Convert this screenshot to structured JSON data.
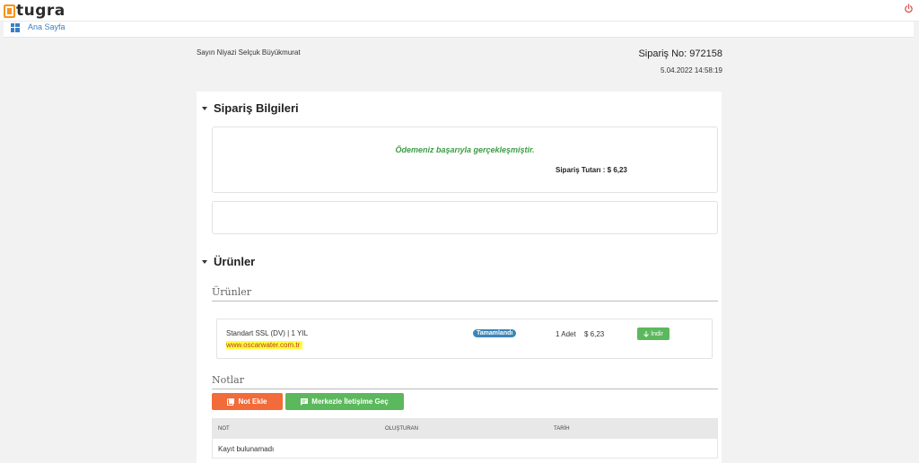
{
  "header": {
    "logo_letter": "E",
    "logo_text": "tugra"
  },
  "nav": {
    "home_label": "Ana Sayfa"
  },
  "order": {
    "customer": "Sayın Niyazi Selçuk Büyükmurat",
    "number": "Sipariş No: 972158",
    "date": "5.04.2022 14:58:19"
  },
  "sections": {
    "order_info_title": "Sipariş Bilgileri",
    "products_title": "Ürünler",
    "products_subtitle": "Ürünler",
    "notes_subtitle": "Notlar"
  },
  "payment": {
    "success_message": "Ödemeniz başarıyla gerçekleşmiştir.",
    "total": "Sipariş Tutarı : $ 6,23"
  },
  "product": {
    "name": "Standart SSL (DV) | 1 YIL",
    "domain": "www.oscarwater.com.tr",
    "status": "Tamamlandı",
    "quantity": "1 Adet",
    "price": "$ 6,23",
    "download_label": "İndir"
  },
  "notes": {
    "add_note_label": "Not Ekle",
    "contact_label": "Merkezle İletişime Geç",
    "columns": [
      "NOT",
      "OLUŞTURAN",
      "TARİH"
    ],
    "empty_text": "Kayıt bulunamadı"
  },
  "colors": {
    "accent_orange": "#f7941d",
    "success_green": "#3d9b46",
    "button_green": "#5cb85c",
    "button_orange": "#f26b3a",
    "badge_blue": "#3b86b5",
    "link_blue": "#3a7fc4",
    "power_red": "#d9534f"
  },
  "icons": [
    "power-icon",
    "dashboard-icon",
    "caret-down-icon",
    "download-arrow-icon",
    "note-icon",
    "chat-icon"
  ]
}
